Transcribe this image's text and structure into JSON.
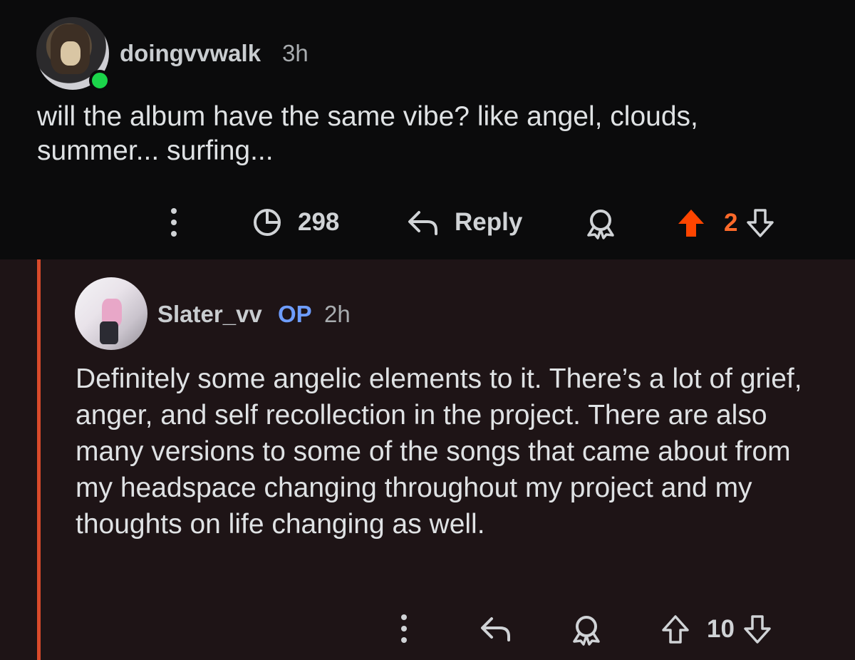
{
  "comment": {
    "username": "doingvvwalk",
    "time": "3h",
    "text": "will the album have the same vibe? like angel, clouds, summer... surfing...",
    "views": "298",
    "reply_label": "Reply",
    "votes": "2",
    "upvote_color": "#ff4500"
  },
  "reply": {
    "username": "Slater_vv",
    "badge": "OP",
    "time": "2h",
    "text": "Definitely some angelic elements to it. There’s a lot of grief, anger, and self recollection in the project. There are also many versions to some of the songs that came about from my headspace changing throughout my project and my thoughts on life changing as well.",
    "votes": "10",
    "badge_color": "#6e9dff",
    "thread_color": "#d84a2b"
  },
  "icons": [
    "more-icon",
    "views-icon",
    "reply-icon",
    "award-icon",
    "upvote-icon",
    "downvote-icon"
  ]
}
